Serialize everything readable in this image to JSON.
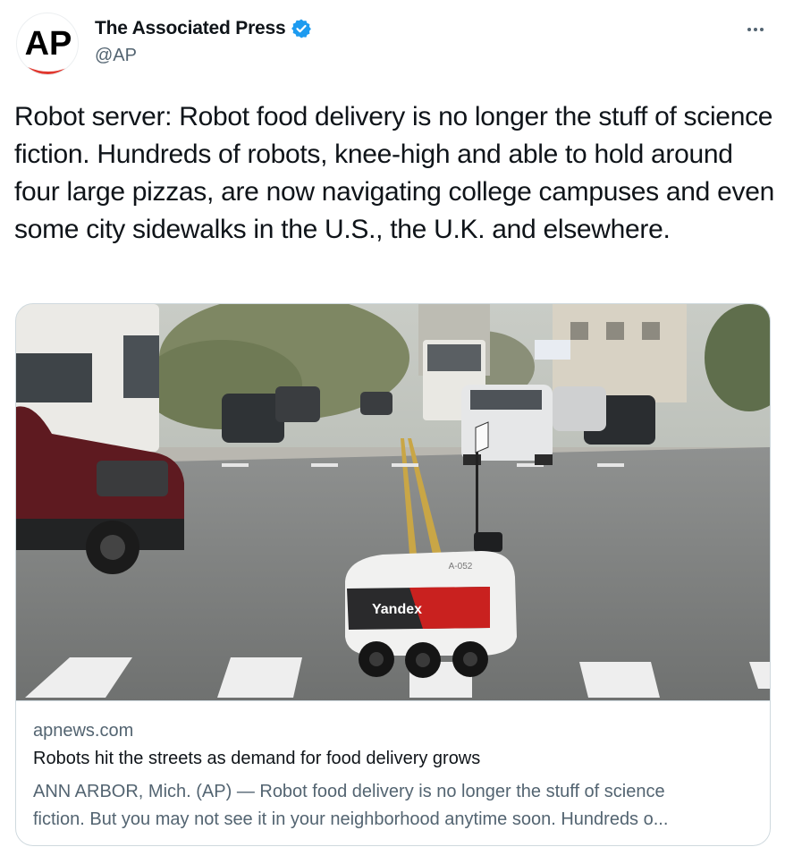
{
  "author": {
    "display_name": "The Associated Press",
    "handle": "@AP",
    "avatar_text": "AP",
    "verified": true,
    "verified_color": "#1d9bf0",
    "avatar_accent": "#e0372e"
  },
  "more_menu_icon": "more-horizontal-icon",
  "tweet": {
    "text": "Robot server: Robot food delivery is no longer the stuff of science fiction. Hundreds of robots, knee-high and able to hold around four large pizzas, are now navigating college campuses and even some city sidewalks in the U.S., the U.K. and elsewhere."
  },
  "card": {
    "image_text": "Yandex",
    "image_robot_id": "A-052",
    "domain": "apnews.com",
    "title": "Robots hit the streets as demand for food delivery grows",
    "description_line1": "ANN ARBOR, Mich. (AP) — Robot food delivery is no longer the stuff of science",
    "description_line2": "fiction. But you may not see it in your neighborhood anytime soon. Hundreds o..."
  }
}
